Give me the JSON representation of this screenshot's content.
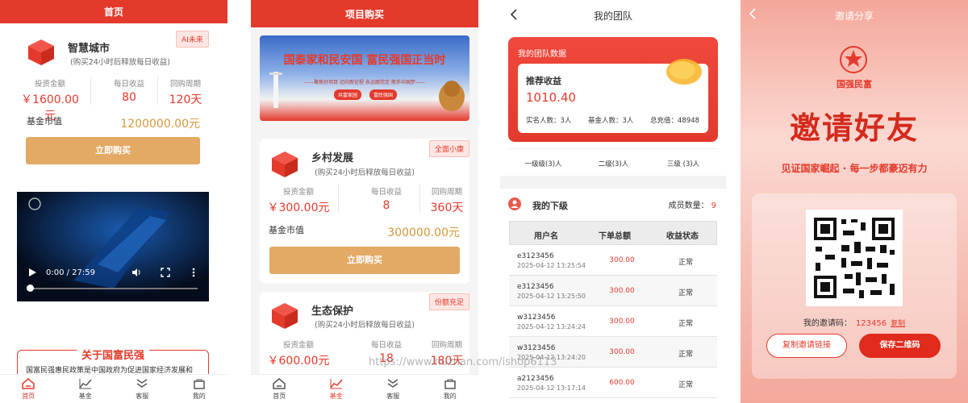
{
  "s1": {
    "title": "首页",
    "product": {
      "name": "智慧城市",
      "sub": "(购买24小时后释放每日收益)",
      "badge": "AI未来",
      "stats": [
        {
          "label": "投资金额",
          "value": "￥1600.00元"
        },
        {
          "label": "每日收益",
          "value": "80"
        },
        {
          "label": "回购周期",
          "value": "120天"
        }
      ],
      "fund_label": "基金市值",
      "fund_value": "1200000.00元",
      "buy": "立即购买"
    },
    "video": {
      "time": "0:00 / 27:59"
    },
    "about": {
      "title": "关于国富民强",
      "text": "国富民强惠民政策是中国政府为促进国家经济发展和"
    },
    "tabs": [
      "首页",
      "基金",
      "客服",
      "我的"
    ]
  },
  "s2": {
    "title": "项目购买",
    "banner": {
      "headline": "国泰家和民安国 富民强国正当时",
      "slogan": "——聚焦好项目 迈向新征程 永远跟党走 携手中国梦——",
      "btn1": "共富家园",
      "btn2": "富民强国"
    },
    "products": [
      {
        "name": "乡村发展",
        "sub": "(购买24小时后释放每日收益)",
        "badge": "全面小康",
        "stats": [
          {
            "label": "投资金额",
            "value": "￥300.00元"
          },
          {
            "label": "每日收益",
            "value": "8"
          },
          {
            "label": "回购周期",
            "value": "360天"
          }
        ],
        "fund_label": "基金市值",
        "fund_value": "300000.00元",
        "buy": "立即购买"
      },
      {
        "name": "生态保护",
        "sub": "(购买24小时后释放每日收益)",
        "badge": "份额充足",
        "stats": [
          {
            "label": "投资金额",
            "value": "￥600.00元"
          },
          {
            "label": "每日收益",
            "value": "18"
          },
          {
            "label": "回购周期",
            "value": "180天"
          }
        ]
      }
    ],
    "tabs": [
      "首页",
      "基金",
      "客服",
      "我的"
    ],
    "watermark": "https://www.huzhan.com/ishop6113"
  },
  "s3": {
    "title": "我的团队",
    "team_data": "我的团队数据",
    "rec_label": "推荐收益",
    "rec_value": "1010.40",
    "counts": [
      "实名人数：3人",
      "基金人数：3人",
      "总充值：48948"
    ],
    "levels": [
      "一级级(3)人",
      "二级(3)人",
      "三级 (3)人"
    ],
    "sub_title": "我的下级",
    "member_label": "成员数量：",
    "member_count": "9",
    "headers": [
      "用户名",
      "下单总额",
      "收益状态"
    ],
    "rows": [
      {
        "user": "e3123456",
        "time": "2025-04-12 13:25:54",
        "amount": "300.00",
        "status": "正常"
      },
      {
        "user": "e3123456",
        "time": "2025-04-12 13:25:50",
        "amount": "300.00",
        "status": "正常"
      },
      {
        "user": "w3123456",
        "time": "2025-04-12 13:24:24",
        "amount": "300.00",
        "status": "正常"
      },
      {
        "user": "w3123456",
        "time": "2025-04-12 13:24:20",
        "amount": "300.00",
        "status": "正常"
      },
      {
        "user": "a2123456",
        "time": "2025-04-12 13:17:14",
        "amount": "600.00",
        "status": "正常"
      }
    ]
  },
  "s4": {
    "title": "邀请分享",
    "brand": "国强民富",
    "headline": "邀请好友",
    "slogan": "见证国家崛起 · 每一步都豪迈有力",
    "code_label": "我的邀请码：",
    "code": "123456",
    "copy": "复制",
    "copy_link": "复制邀请链接",
    "save_qr": "保存二维码"
  }
}
